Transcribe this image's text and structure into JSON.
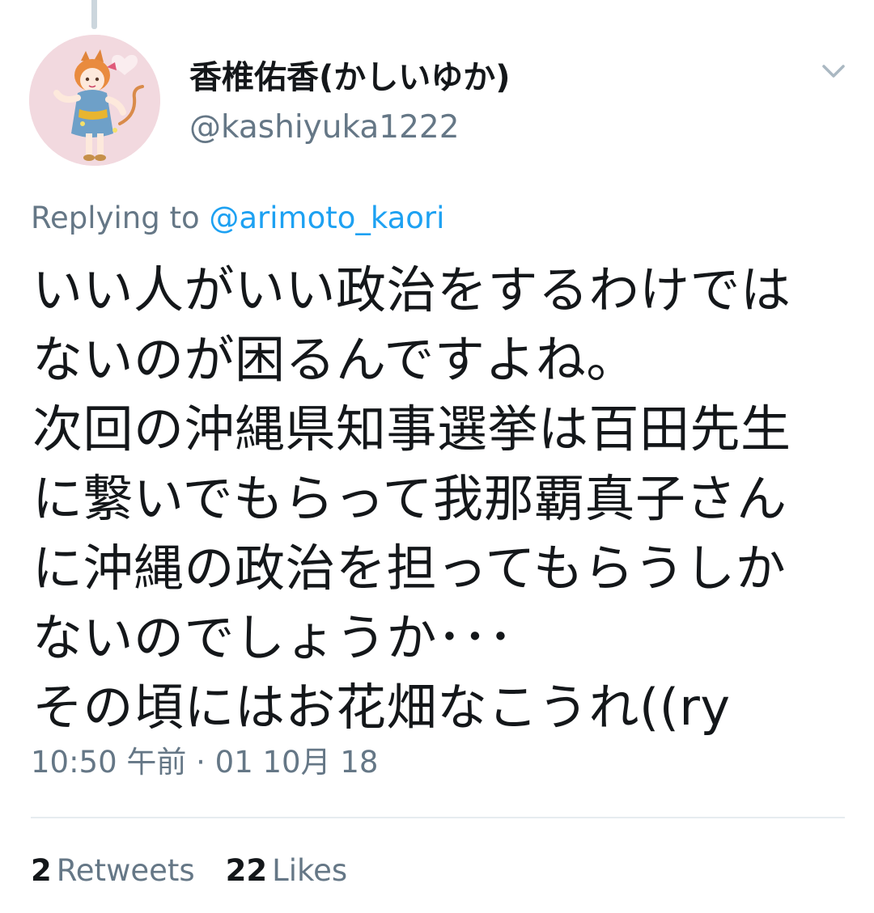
{
  "colors": {
    "primary_text": "#14171a",
    "secondary_text": "#657786",
    "link": "#1da1f2",
    "divider": "#e6ecf0",
    "thread_line": "#ccd6dd"
  },
  "author": {
    "display_name": "香椎佑香(かしいゆか)",
    "handle": "@kashiyuka1222",
    "avatar_icon": "avatar-illustration"
  },
  "menu": {
    "icon": "chevron-down-icon"
  },
  "reply": {
    "prefix": "Replying to ",
    "mention": "@arimoto_kaori"
  },
  "tweet": {
    "lines": [
      "いい人がいい政治をするわけでは",
      "ないのが困るんですよね。",
      "次回の沖縄県知事選挙は百田先生",
      "に繋いでもらって我那覇真子さん",
      "に沖縄の政治を担ってもらうしか",
      "ないのでしょうか･･･",
      "その頃にはお花畑なこうれ((ry"
    ]
  },
  "meta": {
    "timestamp": "10:50 午前 · 01 10月 18"
  },
  "stats": {
    "retweets_count": "2",
    "retweets_label": "Retweets",
    "likes_count": "22",
    "likes_label": "Likes"
  }
}
